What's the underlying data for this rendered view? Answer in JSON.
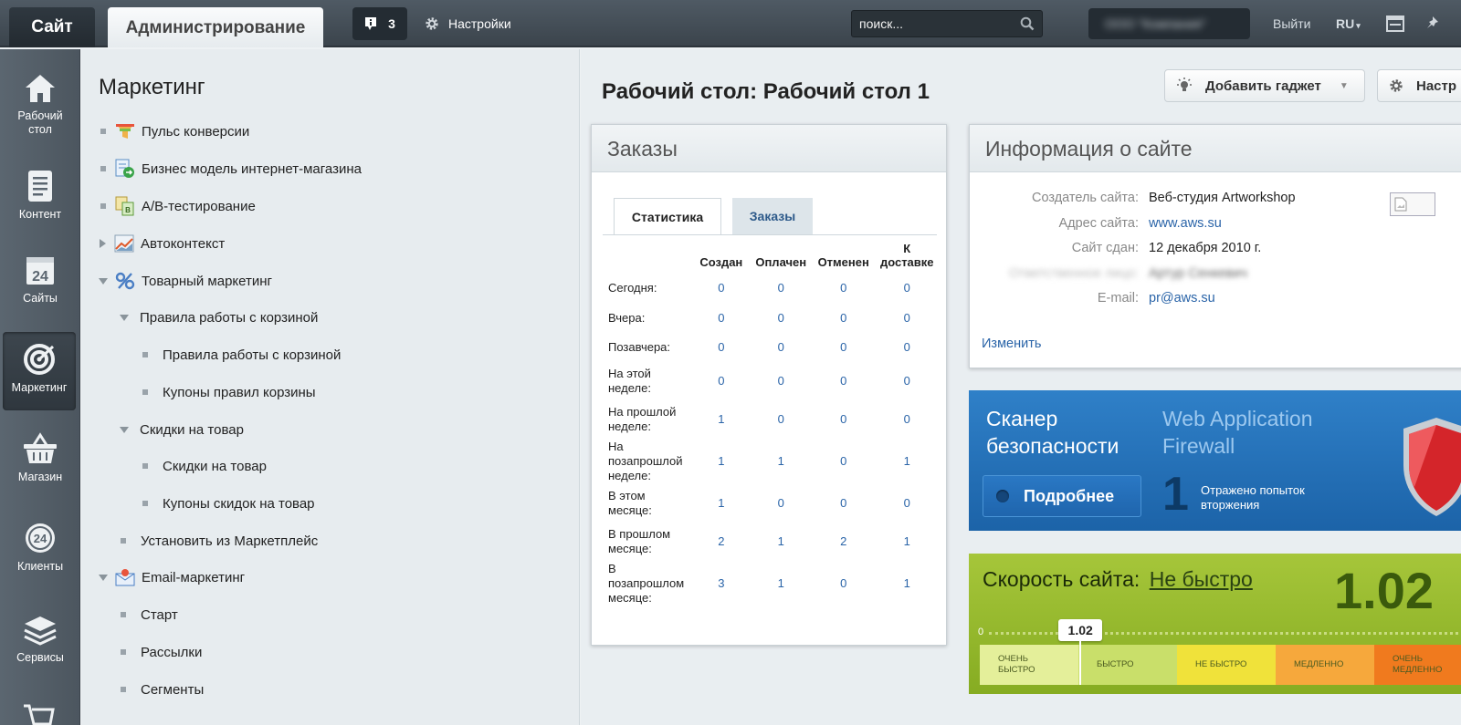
{
  "topbar": {
    "site_tab": "Сайт",
    "admin_tab": "Администрирование",
    "notifications_count": "3",
    "settings_label": "Настройки",
    "search_placeholder": "поиск...",
    "user_name": "ООО \"Компания\"",
    "logout_label": "Выйти",
    "language": "RU"
  },
  "leftnav": {
    "items": [
      {
        "label_line1": "Рабочий",
        "label_line2": "стол",
        "icon": "home-icon"
      },
      {
        "label": "Контент",
        "icon": "document-icon"
      },
      {
        "label": "Сайты",
        "icon": "calendar-icon"
      },
      {
        "label": "Маркетинг",
        "icon": "target-icon",
        "active": true
      },
      {
        "label": "Магазин",
        "icon": "basket-icon"
      },
      {
        "label": "Клиенты",
        "icon": "clients-icon"
      },
      {
        "label": "Сервисы",
        "icon": "layers-icon"
      }
    ]
  },
  "menu": {
    "title": "Маркетинг",
    "items": [
      {
        "label": "Пульс конверсии"
      },
      {
        "label": "Бизнес модель интернет-магазина"
      },
      {
        "label": "А/В-тестирование"
      },
      {
        "label": "Автоконтекст"
      },
      {
        "label": "Товарный маркетинг"
      },
      {
        "label": "Правила работы с корзиной"
      },
      {
        "label": "Правила работы с корзиной"
      },
      {
        "label": "Купоны правил корзины"
      },
      {
        "label": "Скидки на товар"
      },
      {
        "label": "Скидки на товар"
      },
      {
        "label": "Купоны скидок на товар"
      },
      {
        "label": "Установить из Маркетплейс"
      },
      {
        "label": "Email-маркетинг"
      },
      {
        "label": "Старт"
      },
      {
        "label": "Рассылки"
      },
      {
        "label": "Сегменты"
      }
    ]
  },
  "main": {
    "title": "Рабочий стол: Рабочий стол 1",
    "add_gadget_label": "Добавить гаджет",
    "settings_label": "Настр"
  },
  "orders": {
    "title": "Заказы",
    "tabs": [
      "Статистика",
      "Заказы"
    ],
    "columns": [
      "Создан",
      "Оплачен",
      "Отменен",
      "К доставке"
    ],
    "rows": [
      {
        "period": "Сегодня:",
        "values": [
          "0",
          "0",
          "0",
          "0"
        ]
      },
      {
        "period": "Вчера:",
        "values": [
          "0",
          "0",
          "0",
          "0"
        ]
      },
      {
        "period": "Позавчера:",
        "values": [
          "0",
          "0",
          "0",
          "0"
        ]
      },
      {
        "period": "На этой неделе:",
        "values": [
          "0",
          "0",
          "0",
          "0"
        ]
      },
      {
        "period": "На прошлой неделе:",
        "values": [
          "1",
          "0",
          "0",
          "0"
        ]
      },
      {
        "period": "На позапрошлой неделе:",
        "values": [
          "1",
          "1",
          "0",
          "1"
        ]
      },
      {
        "period": "В этом месяце:",
        "values": [
          "1",
          "0",
          "0",
          "0"
        ]
      },
      {
        "period": "В прошлом месяце:",
        "values": [
          "2",
          "1",
          "2",
          "1"
        ]
      },
      {
        "period": "В позапрошлом месяце:",
        "values": [
          "3",
          "1",
          "0",
          "1"
        ]
      }
    ]
  },
  "site_info": {
    "title": "Информация о сайте",
    "rows": [
      {
        "label": "Создатель сайта:",
        "value": "Веб-студия Artworkshop",
        "link": false
      },
      {
        "label": "Адрес сайта:",
        "value": "www.aws.su",
        "link": true
      },
      {
        "label": "Сайт сдан:",
        "value": "12 декабря 2010 г.",
        "link": false
      },
      {
        "label": "Ответственное лицо:",
        "value": "Артур Сенкевич",
        "link": false,
        "blurred": true
      },
      {
        "label": "E-mail:",
        "value": "pr@aws.su",
        "link": true
      }
    ],
    "edit_label": "Изменить"
  },
  "security": {
    "title": "Сканер безопасности",
    "waf_title": "Web Application Firewall",
    "details_label": "Подробнее",
    "count": "1",
    "count_caption": "Отражено попыток вторжения"
  },
  "speed": {
    "title_prefix": "Скорость сайта:",
    "status": "Не быстро",
    "value": "1.02",
    "scale_start": "0",
    "zones": [
      "ОЧЕНЬ БЫСТРО",
      "БЫСТРО",
      "НЕ БЫСТРО",
      "МЕДЛЕННО",
      "ОЧЕНЬ МЕДЛЕННО"
    ],
    "colors": [
      "#e4ef9a",
      "#c9df6a",
      "#f0e23a",
      "#f6a83c",
      "#f07a1e"
    ]
  },
  "colors": {
    "link": "#2a64a8",
    "topbar": "#4f5a64",
    "security_bg": "#2470b8",
    "speed_bg": "#98ba2e"
  }
}
